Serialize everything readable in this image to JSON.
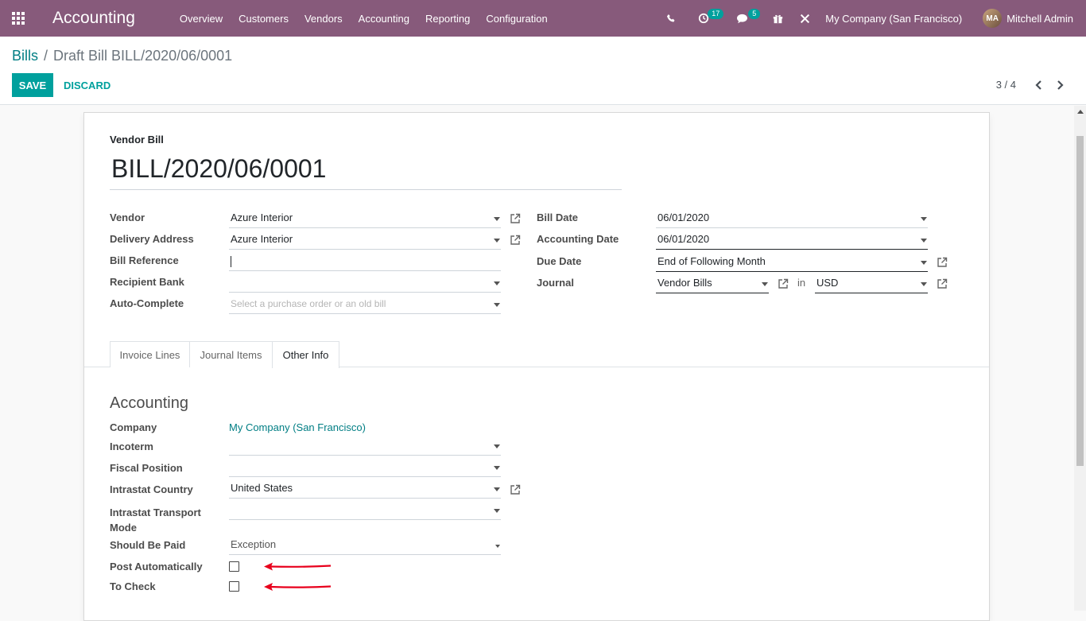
{
  "navbar": {
    "app_name": "Accounting",
    "menu": [
      "Overview",
      "Customers",
      "Vendors",
      "Accounting",
      "Reporting",
      "Configuration"
    ],
    "activity_count": "17",
    "message_count": "5",
    "company": "My Company (San Francisco)",
    "user": "Mitchell Admin"
  },
  "control_panel": {
    "breadcrumb_parent": "Bills",
    "breadcrumb_separator": "/",
    "breadcrumb_current": "Draft Bill BILL/2020/06/0001",
    "save_label": "SAVE",
    "discard_label": "DISCARD",
    "pager": "3 / 4"
  },
  "form": {
    "doc_type": "Vendor Bill",
    "name": "BILL/2020/06/0001",
    "left": {
      "vendor_label": "Vendor",
      "vendor_value": "Azure Interior",
      "delivery_label": "Delivery Address",
      "delivery_value": "Azure Interior",
      "bill_ref_label": "Bill Reference",
      "bill_ref_value": "",
      "bank_label": "Recipient Bank",
      "bank_value": "",
      "autocomplete_label": "Auto-Complete",
      "autocomplete_placeholder": "Select a purchase order or an old bill"
    },
    "right": {
      "bill_date_label": "Bill Date",
      "bill_date_value": "06/01/2020",
      "acc_date_label": "Accounting Date",
      "acc_date_value": "06/01/2020",
      "due_date_label": "Due Date",
      "due_date_value": "End of Following Month",
      "journal_label": "Journal",
      "journal_value": "Vendor Bills",
      "in_label": "in",
      "currency_value": "USD"
    },
    "tabs": [
      "Invoice Lines",
      "Journal Items",
      "Other Info"
    ],
    "active_tab": "Other Info",
    "other_info": {
      "section_title": "Accounting",
      "company_label": "Company",
      "company_value": "My Company (San Francisco)",
      "incoterm_label": "Incoterm",
      "incoterm_value": "",
      "fiscal_label": "Fiscal Position",
      "fiscal_value": "",
      "intrastat_country_label": "Intrastat Country",
      "intrastat_country_value": "United States",
      "transport_label_1": "Intrastat Transport",
      "transport_label_2": "Mode",
      "transport_value": "",
      "should_pay_label": "Should Be Paid",
      "should_pay_value": "Exception",
      "post_auto_label": "Post Automatically",
      "post_auto_checked": false,
      "to_check_label": "To Check",
      "to_check_checked": false
    }
  },
  "colors": {
    "navbar": "#875a7b",
    "primary": "#00a09d",
    "link": "#017e84",
    "annotation_arrow": "#e8001c"
  }
}
